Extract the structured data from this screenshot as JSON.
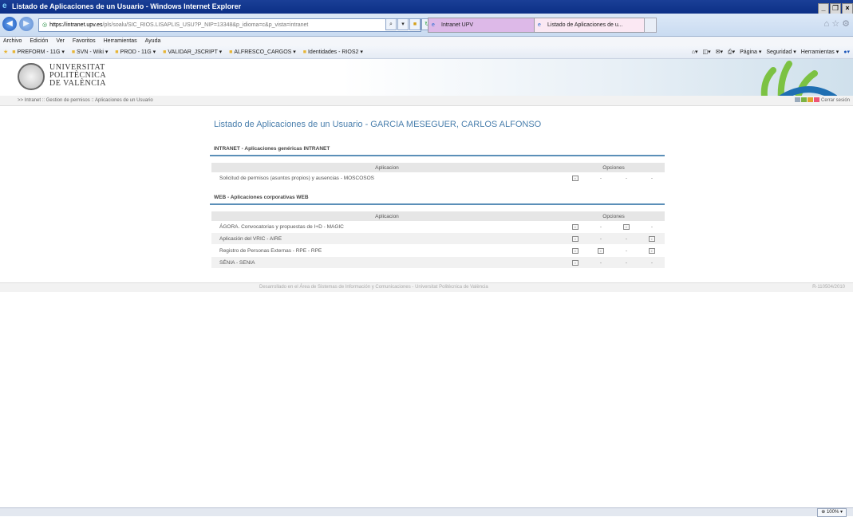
{
  "window": {
    "title": "Listado de Aplicaciones de un Usuario - Windows Internet Explorer"
  },
  "address": {
    "host": "https://intranet.upv.es",
    "path": "/pls/soalu/SIC_RIOS.LISAPLIS_USU?P_NIP=13348&p_idioma=c&p_vista=intranet"
  },
  "tabs": [
    {
      "label": "Intranet UPV"
    },
    {
      "label": "Listado de Aplicaciones de u..."
    }
  ],
  "menu": [
    "Archivo",
    "Edición",
    "Ver",
    "Favoritos",
    "Herramientas",
    "Ayuda"
  ],
  "favorites": [
    "PREFORM - 11G ▾",
    "SVN - Wiki ▾",
    "PROD - 11G ▾",
    "VALIDAR_JSCRIPT ▾",
    "ALFRESCO_CARGOS ▾",
    "Identidades - RIOS2 ▾"
  ],
  "commandbar": [
    "Página ▾",
    "Seguridad ▾",
    "Herramientas ▾"
  ],
  "university": {
    "line1": "UNIVERSITAT",
    "line2": "POLITÈCNICA",
    "line3": "DE VALÈNCIA"
  },
  "breadcrumb": ">> Intranet :: Gestion de permisos :: Aplicaciones de un Usuario",
  "logout": "Cerrar sesión",
  "page_title": "Listado de Aplicaciones de un Usuario - GARCIA MESEGUER, CARLOS ALFONSO",
  "sections": [
    {
      "title": "INTRANET - Aplicaciones genéricas INTRANET",
      "col_app": "Aplicacion",
      "col_opt": "Opciones",
      "rows": [
        {
          "name": "Solicitud de permisos (asuntos propios) y ausencias - MOSCOSOS",
          "o1": "▪",
          "o2": "-",
          "o3": "-",
          "o4": "-"
        }
      ]
    },
    {
      "title": "WEB - Aplicaciones corporativas WEB",
      "col_app": "Aplicacion",
      "col_opt": "Opciones",
      "rows": [
        {
          "name": "ÁGORA. Convocatorias y propuestas de I+D - MAGIC",
          "o1": "▪",
          "o2": "-",
          "o3": "▪",
          "o4": "-"
        },
        {
          "name": "Aplicación del VRIC - AIRE",
          "o1": "▪",
          "o2": "-",
          "o3": "-",
          "o4": "▪"
        },
        {
          "name": "Registro de Personas Externas - RPE - RPE",
          "o1": "▪",
          "o2": "▪",
          "o3": "-",
          "o4": "▪"
        },
        {
          "name": "SÉNIA - SENIA",
          "o1": "▪",
          "o2": "-",
          "o3": "-",
          "o4": "-"
        }
      ]
    }
  ],
  "footer": {
    "text": "Desarrollado en el Área de Sistemas de Información y Comunicaciones - Universitat Politècnica de València",
    "version": "R-110504/2010"
  },
  "status": {
    "zoom": "100%"
  }
}
